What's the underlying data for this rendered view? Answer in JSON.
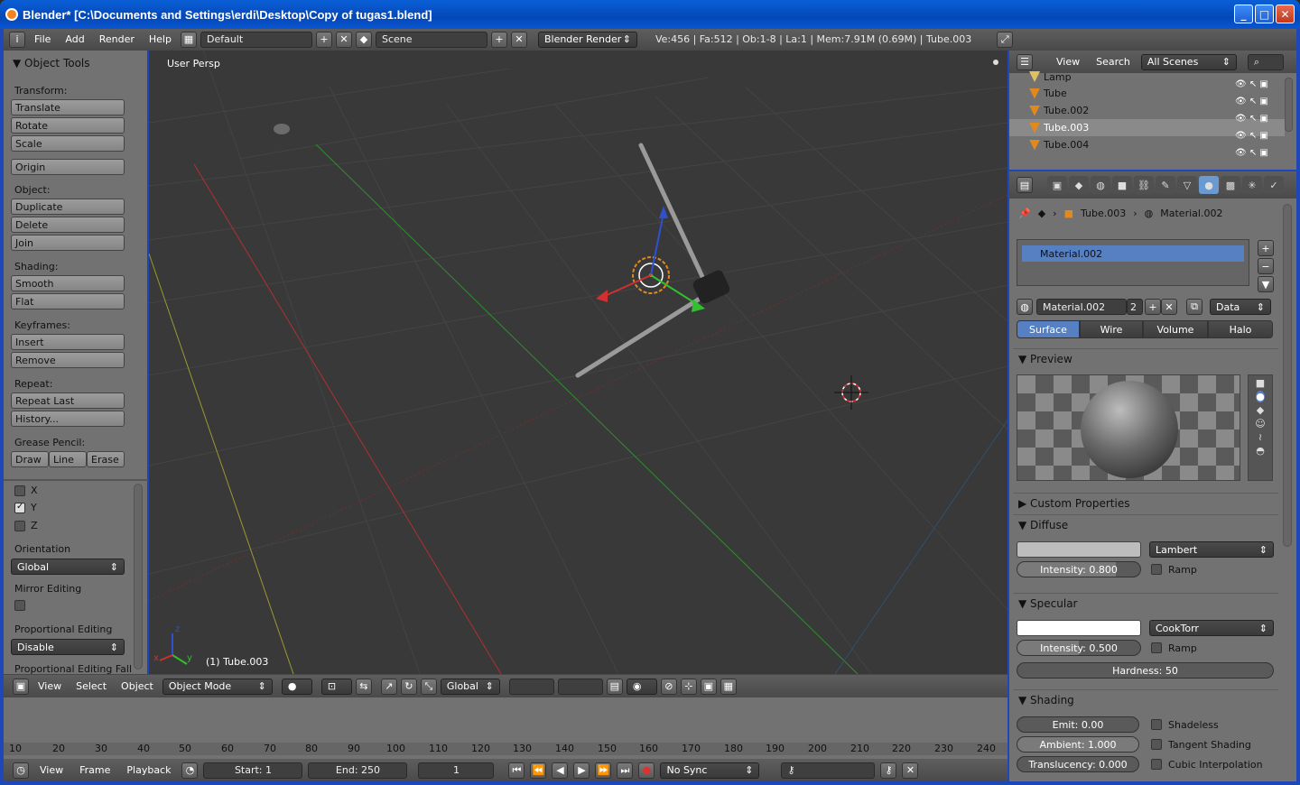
{
  "window": {
    "title": "Blender* [C:\\Documents and Settings\\erdi\\Desktop\\Copy of tugas1.blend]"
  },
  "topbar": {
    "menus": [
      "File",
      "Add",
      "Render",
      "Help"
    ],
    "layout": "Default",
    "scene": "Scene",
    "engine": "Blender Render",
    "stats": "Ve:456 | Fa:512 | Ob:1-8 | La:1 | Mem:7.91M (0.69M) | Tube.003"
  },
  "tools": {
    "header": "Object Tools",
    "transform_label": "Transform:",
    "translate": "Translate",
    "rotate": "Rotate",
    "scale": "Scale",
    "origin": "Origin",
    "object_label": "Object:",
    "duplicate": "Duplicate",
    "delete": "Delete",
    "join": "Join",
    "shading_label": "Shading:",
    "smooth": "Smooth",
    "flat": "Flat",
    "keyframes_label": "Keyframes:",
    "insert": "Insert",
    "remove": "Remove",
    "repeat_label": "Repeat:",
    "repeat_last": "Repeat Last",
    "history": "History...",
    "grease_label": "Grease Pencil:",
    "draw": "Draw",
    "line": "Line",
    "erase": "Erase",
    "axis_x": "X",
    "axis_y": "Y",
    "axis_z": "Z",
    "orientation_label": "Orientation",
    "orientation": "Global",
    "mirror_label": "Mirror Editing",
    "prop_label": "Proportional Editing",
    "prop_value": "Disable",
    "prop_falloff": "Proportional Editing Fall"
  },
  "viewport": {
    "view_label": "User Persp",
    "active_obj": "(1) Tube.003",
    "axis_z": "z",
    "axis_y": "y",
    "axis_x": "x"
  },
  "vheader": {
    "view": "View",
    "select": "Select",
    "object": "Object",
    "mode": "Object Mode",
    "orient": "Global"
  },
  "timeline": {
    "ticks": [
      "10",
      "20",
      "30",
      "40",
      "50",
      "60",
      "70",
      "80",
      "90",
      "100",
      "110",
      "120",
      "130",
      "140",
      "150",
      "160",
      "170",
      "180",
      "190",
      "200",
      "210",
      "220",
      "230",
      "240"
    ],
    "view": "View",
    "frame": "Frame",
    "playback": "Playback",
    "start": "Start: 1",
    "end": "End: 250",
    "current": "1",
    "sync": "No Sync"
  },
  "outliner": {
    "view": "View",
    "search": "Search",
    "scenes": "All Scenes",
    "items": [
      "Lamp",
      "Tube",
      "Tube.002",
      "Tube.003",
      "Tube.004"
    ]
  },
  "props": {
    "crumb_obj": "Tube.003",
    "crumb_mat": "Material.002",
    "slot": "Material.002",
    "mat_name": "Material.002",
    "users": "2",
    "link": "Data",
    "tabs": [
      "Surface",
      "Wire",
      "Volume",
      "Halo"
    ],
    "preview": "Preview",
    "custom": "Custom Properties",
    "diffuse": "Diffuse",
    "diffuse_shader": "Lambert",
    "diffuse_intensity": "Intensity: 0.800",
    "diffuse_ramp": "Ramp",
    "specular": "Specular",
    "spec_shader": "CookTorr",
    "spec_intensity": "Intensity: 0.500",
    "spec_ramp": "Ramp",
    "hardness": "Hardness: 50",
    "shading": "Shading",
    "emit": "Emit: 0.00",
    "ambient": "Ambient: 1.000",
    "translucency": "Translucency: 0.000",
    "shadeless": "Shadeless",
    "tangent": "Tangent Shading",
    "cubic": "Cubic Interpolation"
  },
  "colors": {
    "accent": "#5680c2",
    "title_blue": "#0a5fd6",
    "panel": "#727272",
    "viewport": "#393939"
  }
}
